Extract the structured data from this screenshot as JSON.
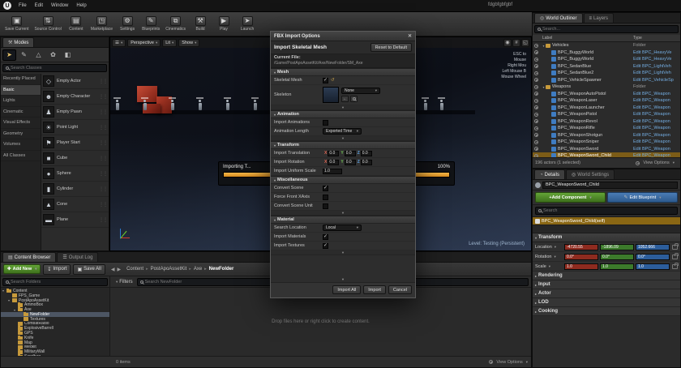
{
  "window": {
    "title": "fdgbfgbfgbf"
  },
  "menubar": {
    "items": [
      "File",
      "Edit",
      "Window",
      "Help"
    ]
  },
  "axes": {
    "x": "X",
    "y": "Y",
    "z": "Z"
  },
  "toolbar": {
    "buttons": [
      {
        "label": "Save Current",
        "icon": "save-icon",
        "glyph": "▣"
      },
      {
        "label": "Source Control",
        "icon": "source-control-icon",
        "glyph": "⇅"
      },
      {
        "label": "Content",
        "icon": "content-icon",
        "glyph": "▤"
      },
      {
        "label": "Marketplace",
        "icon": "marketplace-icon",
        "glyph": "◳"
      },
      {
        "label": "Settings",
        "icon": "settings-icon",
        "glyph": "⚙"
      },
      {
        "label": "Blueprints",
        "icon": "blueprints-icon",
        "glyph": "✎"
      },
      {
        "label": "Cinematics",
        "icon": "cinematics-icon",
        "glyph": "⧉"
      },
      {
        "label": "Build",
        "icon": "build-icon",
        "glyph": "⚒"
      },
      {
        "label": "Play",
        "icon": "play-icon",
        "glyph": "▶"
      },
      {
        "label": "Launch",
        "icon": "launch-icon",
        "glyph": "➤"
      }
    ]
  },
  "modes": {
    "tab_title": "Modes",
    "mode_icons": [
      {
        "icon": "place-mode-icon",
        "glyph": "➤",
        "selected": true
      },
      {
        "icon": "paint-mode-icon",
        "glyph": "✎"
      },
      {
        "icon": "landscape-mode-icon",
        "glyph": "△"
      },
      {
        "icon": "foliage-mode-icon",
        "glyph": "✿"
      },
      {
        "icon": "geometry-mode-icon",
        "glyph": "◧"
      }
    ],
    "search_placeholder": "Search Classes",
    "categories": [
      {
        "label": "Recently Placed"
      },
      {
        "label": "Basic",
        "selected": true
      },
      {
        "label": "Lights"
      },
      {
        "label": "Cinematic"
      },
      {
        "label": "Visual Effects"
      },
      {
        "label": "Geometry"
      },
      {
        "label": "Volumes"
      },
      {
        "label": "All Classes"
      }
    ],
    "items": [
      {
        "label": "Empty Actor",
        "glyph": "◇"
      },
      {
        "label": "Empty Character",
        "glyph": "☻"
      },
      {
        "label": "Empty Pawn",
        "glyph": "♟"
      },
      {
        "label": "Point Light",
        "glyph": "☀"
      },
      {
        "label": "Player Start",
        "glyph": "⚑"
      },
      {
        "label": "Cube",
        "glyph": "■"
      },
      {
        "label": "Sphere",
        "glyph": "●"
      },
      {
        "label": "Cylinder",
        "glyph": "▮"
      },
      {
        "label": "Cone",
        "glyph": "▲"
      },
      {
        "label": "Plane",
        "glyph": "▬"
      }
    ]
  },
  "viewport": {
    "perspective_button": "Perspective",
    "lit_button": "Lit",
    "show_button": "Show",
    "help_overlay": [
      "ESC to",
      "Mouse",
      "Right Mou",
      "Left Mouse B",
      "Mouse Wheel"
    ],
    "toast_label": "Importing T...",
    "toast_percent": "100%",
    "level_label": "Level: Testing (Persistent)"
  },
  "fbx_dialog": {
    "title": "FBX Import Options",
    "header_label": "Import Skeletal Mesh",
    "reset_button": "Reset to Default",
    "current_file_label": "Current File:",
    "current_file_path": "/Game/PostApoAssetKit/Axe/NewFolder/SM_Axe",
    "sections": {
      "mesh": {
        "title": "Mesh",
        "skeletal_mesh_label": "Skeletal Mesh",
        "skeleton_label": "Skeleton",
        "skeleton_value": "None"
      },
      "animation": {
        "title": "Animation",
        "import_animations_label": "Import Animations",
        "animation_length_label": "Animation Length",
        "animation_length_value": "Exported Time"
      },
      "transform": {
        "title": "Transform",
        "translation_label": "Import Translation",
        "rotation_label": "Import Rotation",
        "uniform_scale_label": "Import Uniform Scale",
        "translation": {
          "x": "0.0",
          "y": "0.0",
          "z": "0.0"
        },
        "rotation": {
          "x": "0.0",
          "y": "0.0",
          "z": "0.0"
        },
        "uniform_scale": "1.0"
      },
      "miscellaneous": {
        "title": "Miscellaneous",
        "rows": [
          {
            "label": "Convert Scene",
            "checked": true
          },
          {
            "label": "Force Front XAxis",
            "checked": false
          },
          {
            "label": "Convert Scene Unit",
            "checked": false
          }
        ]
      },
      "material": {
        "title": "Material",
        "search_location_label": "Search Location",
        "search_location_value": "Local",
        "rows": [
          {
            "label": "Import Materials",
            "checked": true
          },
          {
            "label": "Import Textures",
            "checked": true
          }
        ]
      }
    },
    "buttons": {
      "import_all": "Import All",
      "import": "Import",
      "cancel": "Cancel"
    }
  },
  "world_outliner": {
    "tab_world_outliner": "World Outliner",
    "tab_layers": "Layers",
    "search_placeholder": "Search...",
    "column_label": "Label",
    "column_type": "Type",
    "rows": [
      {
        "label": "Vehicles",
        "type": "Folder",
        "is_folder": true,
        "depth": 0
      },
      {
        "label": "BPC_BuggyWorld",
        "type": "Edit BPC_HeavyVe",
        "is_link": true,
        "depth": 1
      },
      {
        "label": "BPC_BuggyWorld",
        "type": "Edit BPC_HeavyVe",
        "is_link": true,
        "depth": 1
      },
      {
        "label": "BPC_SedanBlue",
        "type": "Edit BPC_LightVeh",
        "is_link": true,
        "depth": 1
      },
      {
        "label": "BPC_SedanBlue2",
        "type": "Edit BPC_LightVeh",
        "is_link": true,
        "depth": 1
      },
      {
        "label": "BPC_VehicleSpawner",
        "type": "Edit BPC_VehicleSp",
        "is_link": true,
        "depth": 1
      },
      {
        "label": "Weapons",
        "type": "Folder",
        "is_folder": true,
        "depth": 0
      },
      {
        "label": "BPC_WeaponAutoPistol",
        "type": "Edit BPC_Weapon",
        "is_link": true,
        "depth": 1
      },
      {
        "label": "BPC_WeaponLaser",
        "type": "Edit BPC_Weapon",
        "is_link": true,
        "depth": 1
      },
      {
        "label": "BPC_WeaponLauncher",
        "type": "Edit BPC_Weapon",
        "is_link": true,
        "depth": 1
      },
      {
        "label": "BPC_WeaponPistol",
        "type": "Edit BPC_Weapon",
        "is_link": true,
        "depth": 1
      },
      {
        "label": "BPC_WeaponRevol",
        "type": "Edit BPC_Weapon",
        "is_link": true,
        "depth": 1
      },
      {
        "label": "BPC_WeaponRifle",
        "type": "Edit BPC_Weapon",
        "is_link": true,
        "depth": 1
      },
      {
        "label": "BPC_WeaponShotgun",
        "type": "Edit BPC_Weapon",
        "is_link": true,
        "depth": 1
      },
      {
        "label": "BPC_WeaponSniper",
        "type": "Edit BPC_Weapon",
        "is_link": true,
        "depth": 1
      },
      {
        "label": "BPC_WeaponSword",
        "type": "Edit BPC_Weapon",
        "is_link": true,
        "depth": 1
      },
      {
        "label": "BPC_WeaponSword_Child",
        "type": "Edit BPC_Weapon",
        "is_link": true,
        "selected": true,
        "depth": 1
      }
    ],
    "footer": "196 actors (1 selected)",
    "view_options": "View Options"
  },
  "details": {
    "tab_details": "Details",
    "tab_world_settings": "World Settings",
    "actor_name": "BPC_WeaponSword_Child",
    "add_component_button": "+Add Component",
    "edit_blueprint_button": "Edit Blueprint",
    "search_placeholder": "Search",
    "self_row": "BPC_WeaponSword_Child(self)",
    "transform_section": "Transform",
    "location_label": "Location",
    "rotation_label": "Rotation",
    "scale_label": "Scale",
    "location": {
      "x": "-4720.55",
      "y": "-1896.09",
      "z": "1052.666"
    },
    "rotation": {
      "x": "0.0°",
      "y": "0.0°",
      "z": "0.0°"
    },
    "scale": {
      "x": "1.0",
      "y": "1.0",
      "z": "1.0"
    },
    "sections": [
      "Rendering",
      "Input",
      "Actor",
      "LOD",
      "Cooking"
    ]
  },
  "content_browser": {
    "tab_content_browser": "Content Browser",
    "tab_output_log": "Output Log",
    "add_new_button": "Add New",
    "import_button": "Import",
    "save_all_button": "Save All",
    "breadcrumb": [
      {
        "label": "Content"
      },
      {
        "label": "PostApoAssetKit"
      },
      {
        "label": "Axe"
      },
      {
        "label": "NewFolder",
        "current": true
      }
    ],
    "filters_button": "Filters",
    "search_folders_placeholder": "Search Folders",
    "search_assets_placeholder": "Search NewFolder",
    "tree": [
      {
        "label": "Content",
        "depth": 0,
        "expanded": true
      },
      {
        "label": "FPS_Game",
        "depth": 1
      },
      {
        "label": "PostApoAssetKit",
        "depth": 1,
        "expanded": true
      },
      {
        "label": "AmmoBox",
        "depth": 2
      },
      {
        "label": "Axe",
        "depth": 2,
        "expanded": true
      },
      {
        "label": "NewFolder",
        "depth": 3,
        "selected": true
      },
      {
        "label": "Textures",
        "depth": 3
      },
      {
        "label": "CombatRadio",
        "depth": 2
      },
      {
        "label": "ExplosiveBarrell",
        "depth": 2
      },
      {
        "label": "GPS",
        "depth": 2
      },
      {
        "label": "Knife",
        "depth": 2
      },
      {
        "label": "Map",
        "depth": 2
      },
      {
        "label": "Medkit",
        "depth": 2
      },
      {
        "label": "MilitaryWall",
        "depth": 2
      },
      {
        "label": "Sandbag",
        "depth": 2
      }
    ],
    "empty_message": "Drop files here or right click to create content.",
    "items_count": "0 items",
    "view_options": "View Options"
  }
}
